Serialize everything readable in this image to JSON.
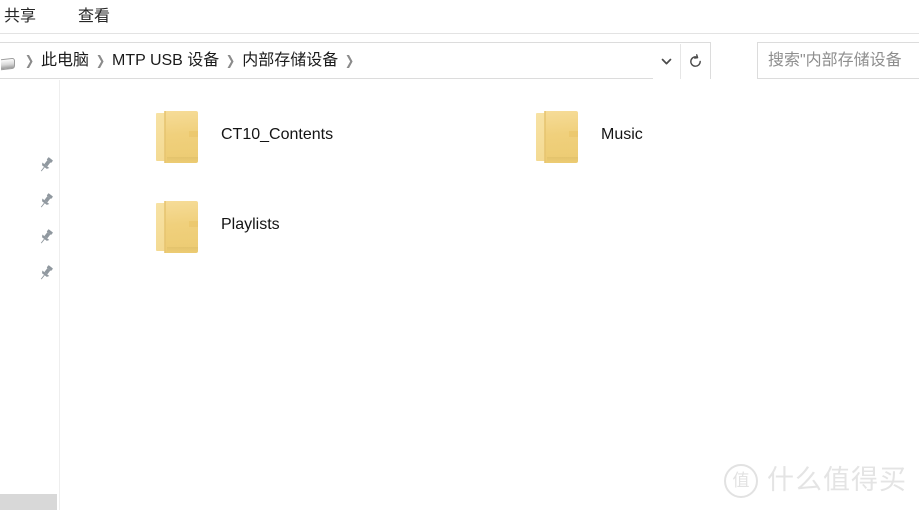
{
  "window": {
    "title": "内部存储设备"
  },
  "ribbon": {
    "tabs": [
      {
        "label": "共享",
        "name": "tab-share"
      },
      {
        "label": "查看",
        "name": "tab-view"
      }
    ]
  },
  "address_bar": {
    "lead_icon": "computer-icon",
    "separator": "❯",
    "crumbs": [
      {
        "label": "此电脑"
      },
      {
        "label": "MTP USB 设备"
      },
      {
        "label": "内部存储设备"
      }
    ],
    "history_dropdown_icon": "chevron-down-icon",
    "refresh_icon": "refresh-icon"
  },
  "search": {
    "placeholder": "搜索\"内部存储设备",
    "value": ""
  },
  "sidebar": {
    "pins": [
      {
        "icon": "pin-icon",
        "label": ""
      },
      {
        "icon": "pin-icon",
        "label": ""
      },
      {
        "icon": "pin-icon",
        "label": ""
      },
      {
        "icon": "pin-icon",
        "label": ""
      }
    ],
    "scrollbar": {
      "orientation": "horizontal"
    }
  },
  "content": {
    "view_mode": "large-icons",
    "items": [
      {
        "name": "CT10_Contents",
        "type": "folder",
        "icon": "folder-icon"
      },
      {
        "name": "Music",
        "type": "folder",
        "icon": "folder-icon"
      },
      {
        "name": "Playlists",
        "type": "folder",
        "icon": "folder-icon"
      }
    ]
  },
  "watermark": {
    "logo_char": "值",
    "text": "什么值得买"
  },
  "colors": {
    "folder_body": "#F0D07C",
    "folder_flap": "#F3D88E",
    "border": "#DCDCDC",
    "text": "#141414",
    "placeholder": "#8E8E8E",
    "pin": "#90989F",
    "scrollbar": "#D8D8D8",
    "watermark": "#E4E4E4"
  }
}
